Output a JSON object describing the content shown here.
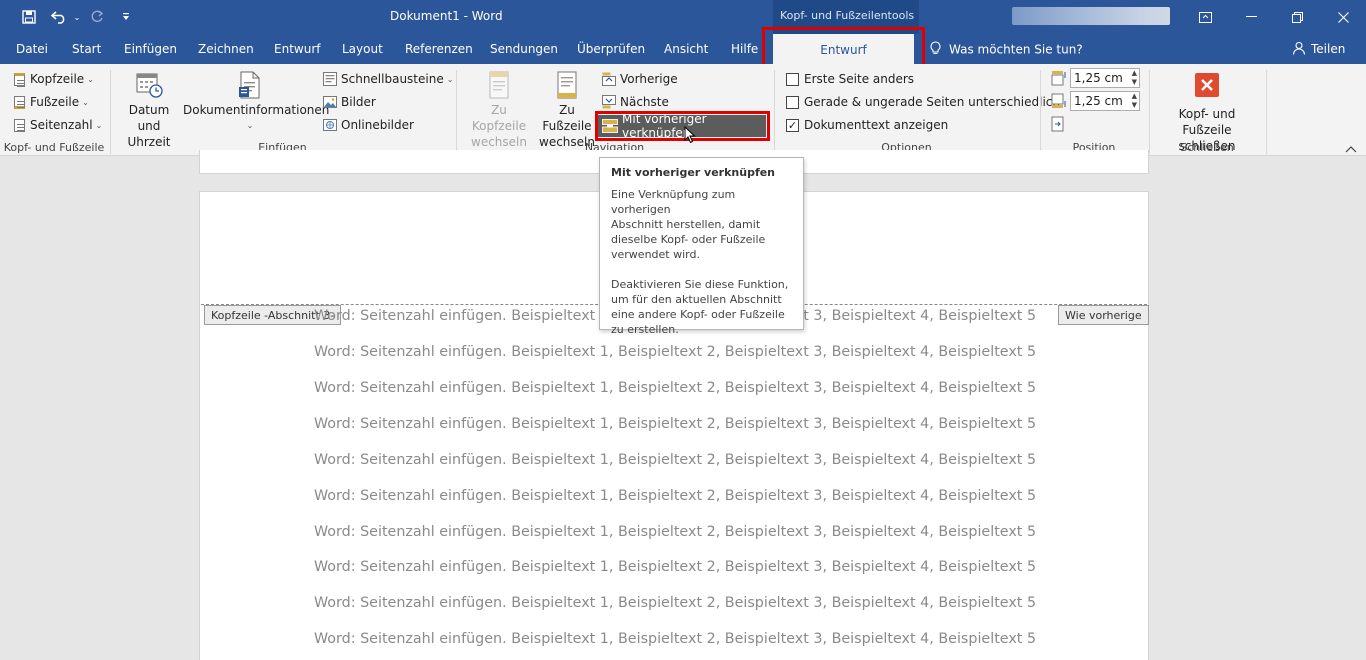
{
  "titlebar": {
    "doc_title": "Dokument1 - Word",
    "context_title": "Kopf- und Fußzeilentools",
    "icons": [
      "save-icon",
      "undo-icon",
      "redo-icon",
      "customize-icon",
      "ribbon-display-icon",
      "minimize-icon",
      "restore-icon",
      "close-icon"
    ]
  },
  "tabs": {
    "items": [
      "Datei",
      "Start",
      "Einfügen",
      "Zeichnen",
      "Entwurf",
      "Layout",
      "Referenzen",
      "Sendungen",
      "Überprüfen",
      "Ansicht",
      "Hilfe"
    ],
    "active": "Entwurf",
    "tell_me": "Was möchten Sie tun?",
    "share": "Teilen"
  },
  "ribbon": {
    "group_header_footer": {
      "label": "Kopf- und Fußzeile",
      "kopfzeile": "Kopfzeile",
      "fusszeile": "Fußzeile",
      "seitenzahl": "Seitenzahl"
    },
    "group_insert": {
      "label": "Einfügen",
      "datum_line1": "Datum und",
      "datum_line2": "Uhrzeit",
      "dokinfo": "Dokumentinformationen",
      "schnellbausteine": "Schnellbausteine",
      "bilder": "Bilder",
      "onlinebilder": "Onlinebilder"
    },
    "group_navigation": {
      "label": "Navigation",
      "zu_kopf_line1": "Zu Kopfzeile",
      "zu_kopf_line2": "wechseln",
      "zu_fuss_line1": "Zu Fußzeile",
      "zu_fuss_line2": "wechseln",
      "vorherige": "Vorherige",
      "naechste": "Nächste",
      "link_previous": "Mit vorheriger verknüpfen"
    },
    "group_options": {
      "label": "Optionen",
      "erste_seite": "Erste Seite anders",
      "erste_seite_checked": false,
      "gerade_ungerade": "Gerade & ungerade Seiten unterschiedlich",
      "gerade_ungerade_checked": false,
      "dokumenttext": "Dokumenttext anzeigen",
      "dokumenttext_checked": true
    },
    "group_position": {
      "label": "Position",
      "header_from_top": "1,25 cm",
      "footer_from_bottom": "1,25 cm"
    },
    "group_close": {
      "label": "Schließen",
      "close_line1": "Kopf- und",
      "close_line2": "Fußzeile schließen"
    }
  },
  "tooltip": {
    "title": "Mit vorheriger verknüpfen",
    "p1": [
      "Eine Verknüpfung zum vorherigen",
      "Abschnitt herstellen, damit",
      "dieselbe Kopf- oder Fußzeile",
      "verwendet wird."
    ],
    "p2": [
      "Deaktivieren Sie diese Funktion,",
      "um für den aktuellen Abschnitt",
      "eine andere Kopf- oder Fußzeile",
      "zu erstellen."
    ]
  },
  "document": {
    "header_tag": "Kopfzeile -Abschnitt 3-",
    "same_as_previous": "Wie vorherige",
    "lines": [
      "Word: Seitenzahl einfügen. Beispieltext 1, Beispieltext 2, Beispieltext 3, Beispieltext 4, Beispieltext 5",
      "Word: Seitenzahl einfügen. Beispieltext 1, Beispieltext 2, Beispieltext 3, Beispieltext 4, Beispieltext 5",
      "Word: Seitenzahl einfügen. Beispieltext 1, Beispieltext 2, Beispieltext 3, Beispieltext 4, Beispieltext 5",
      "Word: Seitenzahl einfügen. Beispieltext 1, Beispieltext 2, Beispieltext 3, Beispieltext 4, Beispieltext 5",
      "Word: Seitenzahl einfügen. Beispieltext 1, Beispieltext 2, Beispieltext 3, Beispieltext 4, Beispieltext 5",
      "Word: Seitenzahl einfügen. Beispieltext 1, Beispieltext 2, Beispieltext 3, Beispieltext 4, Beispieltext 5",
      "Word: Seitenzahl einfügen. Beispieltext 1, Beispieltext 2, Beispieltext 3, Beispieltext 4, Beispieltext 5",
      "Word: Seitenzahl einfügen. Beispieltext 1, Beispieltext 2, Beispieltext 3, Beispieltext 4, Beispieltext 5",
      "Word: Seitenzahl einfügen. Beispieltext 1, Beispieltext 2, Beispieltext 3, Beispieltext 4, Beispieltext 5",
      "Word: Seitenzahl einfügen. Beispieltext 1, Beispieltext 2, Beispieltext 3, Beispieltext 4, Beispieltext 5"
    ]
  },
  "colors": {
    "brand": "#2b579a",
    "highlight": "#e00000",
    "close_red": "#e04a2f"
  }
}
